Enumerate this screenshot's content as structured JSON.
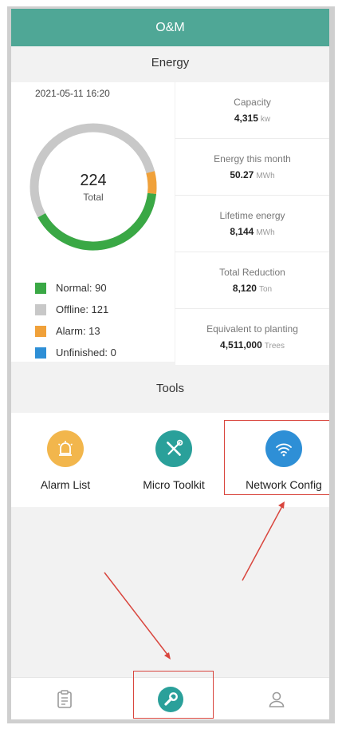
{
  "header": {
    "title": "O&M"
  },
  "energy": {
    "section_title": "Energy",
    "timestamp": "2021-05-11 16:20",
    "total_value": "224",
    "total_label": "Total",
    "status_counts": {
      "normal": 90,
      "offline": 121,
      "alarm": 13,
      "unfinished": 0
    },
    "legend": [
      {
        "label": "Normal: 90",
        "color": "#3aa845"
      },
      {
        "label": "Offline: 121",
        "color": "#c8c8c8"
      },
      {
        "label": "Alarm: 13",
        "color": "#f0a13a"
      },
      {
        "label": "Unfinished: 0",
        "color": "#2e8fd6"
      }
    ],
    "stats": [
      {
        "label": "Capacity",
        "value": "4,315",
        "unit": "kw"
      },
      {
        "label": "Energy this month",
        "value": "50.27",
        "unit": "MWh"
      },
      {
        "label": "Lifetime energy",
        "value": "8,144",
        "unit": "MWh"
      },
      {
        "label": "Total Reduction",
        "value": "8,120",
        "unit": "Ton"
      },
      {
        "label": "Equivalent to planting",
        "value": "4,511,000",
        "unit": "Trees"
      }
    ]
  },
  "tools": {
    "section_title": "Tools",
    "items": [
      {
        "label": "Alarm List",
        "icon": "alarm-siren-icon",
        "color": "#f2b64c"
      },
      {
        "label": "Micro Toolkit",
        "icon": "tools-icon",
        "color": "#2aa09a"
      },
      {
        "label": "Network Config",
        "icon": "wifi-icon",
        "color": "#2e8fd6"
      }
    ]
  },
  "tabbar": {
    "items": [
      {
        "icon": "clipboard-icon",
        "active": false
      },
      {
        "icon": "wrench-icon",
        "active": true
      },
      {
        "icon": "user-icon",
        "active": false
      }
    ],
    "active_color": "#2aa09a"
  },
  "annotation_color": "#d9463e"
}
